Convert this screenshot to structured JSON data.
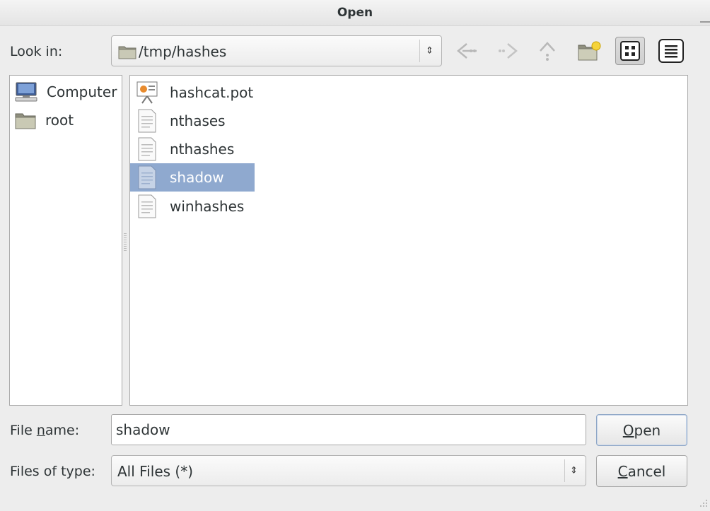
{
  "window": {
    "title": "Open"
  },
  "lookin": {
    "label": "Look in:",
    "path": "/tmp/hashes"
  },
  "nav": {
    "back_icon": "back-arrow-icon",
    "forward_icon": "forward-arrow-icon",
    "up_icon": "up-arrow-icon",
    "newfolder_icon": "new-folder-icon",
    "icon_view_icon": "icon-view-icon",
    "list_view_icon": "list-view-icon"
  },
  "sidebar": {
    "items": [
      {
        "label": "Computer",
        "icon": "computer-icon"
      },
      {
        "label": "root",
        "icon": "folder-icon"
      }
    ]
  },
  "files": [
    {
      "name": "hashcat.pot",
      "icon": "presentation-file-icon",
      "selected": false
    },
    {
      "name": "nthases",
      "icon": "text-file-icon",
      "selected": false
    },
    {
      "name": "nthashes",
      "icon": "text-file-icon",
      "selected": false
    },
    {
      "name": "shadow",
      "icon": "text-file-icon",
      "selected": true
    },
    {
      "name": "winhashes",
      "icon": "text-file-icon",
      "selected": false
    }
  ],
  "filename": {
    "label_pre": "File ",
    "label_mnemonic": "n",
    "label_post": "ame:",
    "value": "shadow"
  },
  "filetype": {
    "label": "Files of type:",
    "value": "All Files (*)"
  },
  "buttons": {
    "open_mnemonic": "O",
    "open_rest": "pen",
    "cancel_mnemonic": "C",
    "cancel_rest": "ancel"
  },
  "colors": {
    "selection": "#8fa9cf",
    "panel_bg": "#ffffff",
    "window_bg": "#ededed"
  }
}
